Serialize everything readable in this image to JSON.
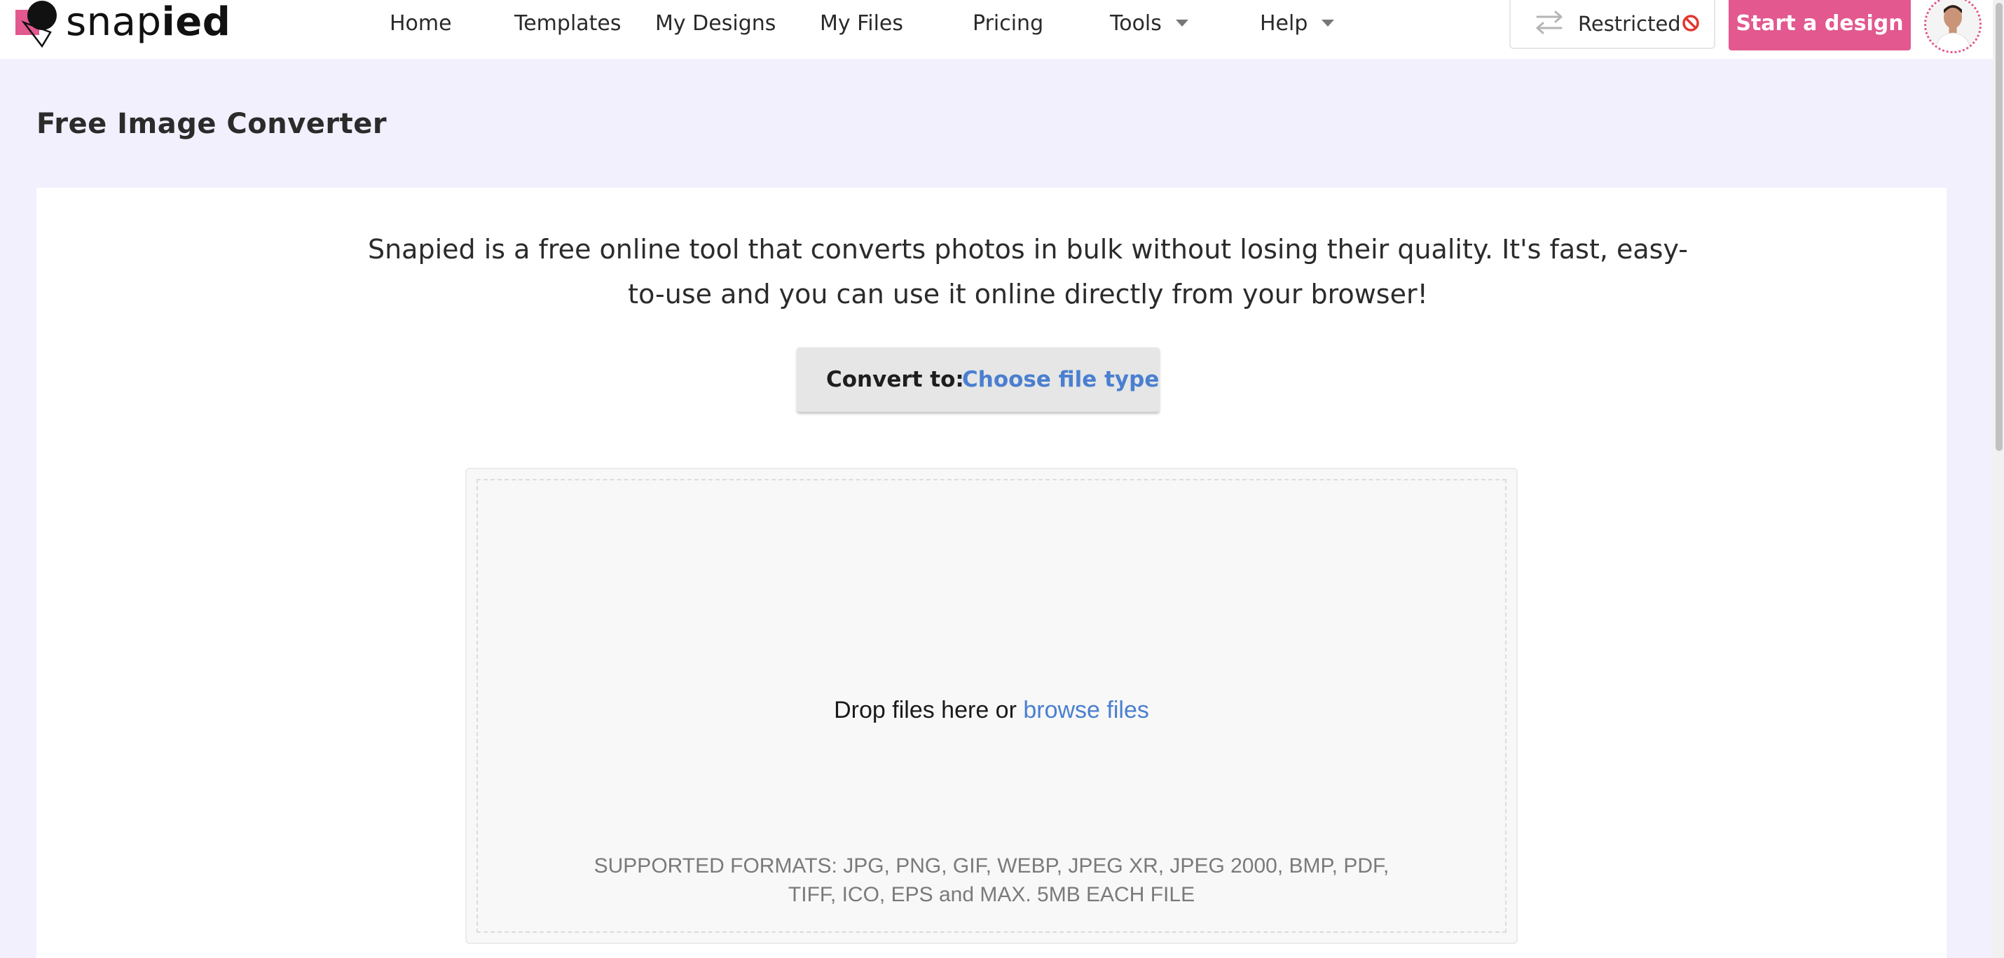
{
  "brand": {
    "name_regular": "snap",
    "name_bold": "ied",
    "accent_color": "#e2588f",
    "link_color": "#4a7fd0"
  },
  "nav": {
    "home": "Home",
    "templates": "Templates",
    "my_designs": "My Designs",
    "my_files": "My Files",
    "pricing": "Pricing",
    "tools": "Tools",
    "help": "Help"
  },
  "header": {
    "restricted_label": "Restricted",
    "restricted_icon": "swap-arrows-icon",
    "start_button": "Start a design",
    "avatar": "user-avatar"
  },
  "page": {
    "title": "Free Image Converter",
    "intro": "Snapied is a free online tool that converts photos in bulk without losing their quality. It's fast, easy-to-use and you can use it online directly from your browser!"
  },
  "converter": {
    "convert_label": "Convert to:",
    "choose_label": "Choose file type"
  },
  "dropzone": {
    "drop_text": "Drop files here or",
    "browse_text": "browse files",
    "formats_text": "SUPPORTED FORMATS: JPG, PNG, GIF, WEBP, JPEG XR, JPEG 2000, BMP, PDF, TIFF, ICO, EPS and MAX. 5MB EACH FILE"
  }
}
